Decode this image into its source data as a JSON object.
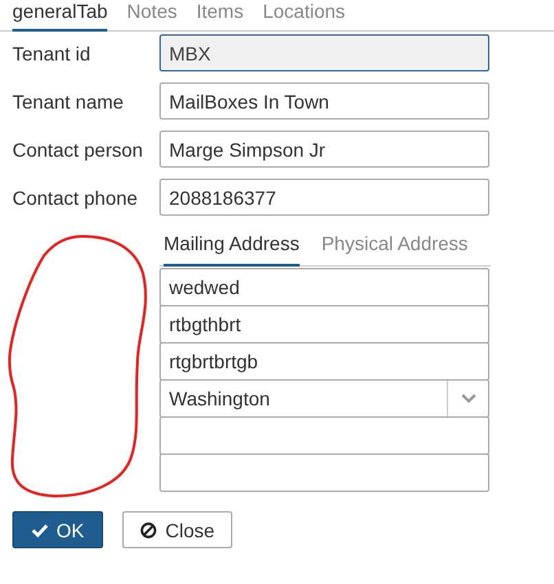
{
  "tabs": [
    {
      "label": "generalTab",
      "selected": true
    },
    {
      "label": "Notes",
      "selected": false
    },
    {
      "label": "Items",
      "selected": false
    },
    {
      "label": "Locations",
      "selected": false
    }
  ],
  "fields": [
    {
      "label": "Tenant id",
      "value": "MBX",
      "disabled": true
    },
    {
      "label": "Tenant name",
      "value": "MailBoxes In Town",
      "disabled": false
    },
    {
      "label": "Contact person",
      "value": "Marge Simpson Jr",
      "disabled": false
    },
    {
      "label": "Contact phone",
      "value": "2088186377",
      "disabled": false
    }
  ],
  "address_tabs": [
    {
      "label": "Mailing Address",
      "selected": true
    },
    {
      "label": "Physical Address",
      "selected": false
    }
  ],
  "address_fields": [
    {
      "kind": "text",
      "value": "wedwed"
    },
    {
      "kind": "text",
      "value": "rtbgthbrt"
    },
    {
      "kind": "text",
      "value": "rtgbrtbrtgb"
    },
    {
      "kind": "select",
      "value": "Washington"
    },
    {
      "kind": "text"
    },
    {
      "kind": "text"
    }
  ],
  "buttons": [
    {
      "kind": "ok",
      "label": "OK"
    },
    {
      "kind": "close",
      "label": "Close"
    }
  ]
}
